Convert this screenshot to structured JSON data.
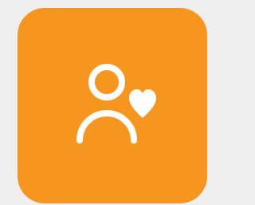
{
  "tile": {
    "icon": "user-heart-icon",
    "background_color": "#F7961F",
    "glyph_color": "#FFFFFF"
  },
  "page": {
    "background_color": "#EFEFEF"
  }
}
